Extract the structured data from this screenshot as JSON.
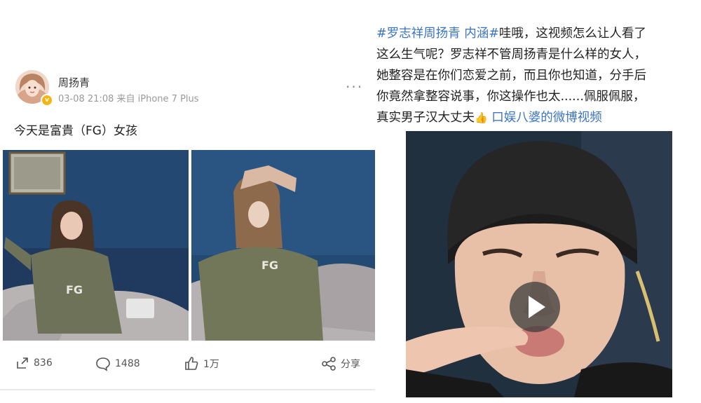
{
  "left_post": {
    "username": "周扬青",
    "timestamp": "03-08 21:08",
    "source": "来自 iPhone 7 Plus",
    "more_label": "···",
    "text": "今天是富貴（FG）女孩",
    "photos": [
      {
        "alt": "photo-1",
        "shirt_text": "FG"
      },
      {
        "alt": "photo-2",
        "shirt_text": "FG"
      }
    ],
    "actions": {
      "repost_count": "836",
      "comment_count": "1488",
      "like_count": "1万",
      "share_label": "分享"
    },
    "verified_badge": "v",
    "badge_color": "#f5b40f"
  },
  "right_post": {
    "hashtag": "#罗志祥周扬青 内涵#",
    "line1_rest": "哇哦，这视频怎么让人看了",
    "line2": "这么生气呢？罗志祥不管周扬青是什么样的女人，",
    "line3": "她整容是在你们恋爱之前，而且你也知道，分手后",
    "line4": "你竟然拿整容说事，你这操作也太......佩服佩服，",
    "line5_plain": "真实男子汉大丈夫",
    "emoji": "👍",
    "video_link": "口娱八婆的微博视频",
    "link_color": "#3b74c4"
  }
}
